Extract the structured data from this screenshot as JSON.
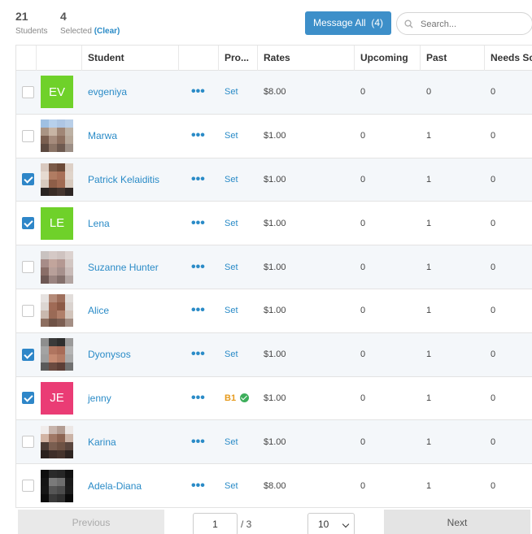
{
  "summary": {
    "students_count": "21",
    "students_label": "Students",
    "selected_count": "4",
    "selected_label": "Selected",
    "clear_label": "(Clear)"
  },
  "toolbar": {
    "message_all_label": "Message All",
    "message_all_count": "(4)",
    "search_placeholder": "Search..."
  },
  "table": {
    "headers": [
      "",
      "",
      "Student",
      "",
      "Pro...",
      "Rates",
      "Upcoming",
      "Past",
      "Needs Sc..."
    ],
    "rows": [
      {
        "checked": false,
        "avatar": {
          "type": "initials",
          "text": "EV",
          "color": "#6fd12a"
        },
        "name": "evgeniya",
        "menu": "•••",
        "program": "Set",
        "rate": "$8.00",
        "upcoming": "0",
        "past": "0",
        "needs": "0"
      },
      {
        "checked": false,
        "avatar": {
          "type": "photo",
          "palette": [
            "#9fc0e2",
            "#b7d0ec",
            "#aec6e4",
            "#b9cfe8",
            "#a99484",
            "#c7b4a4",
            "#a08676",
            "#bdb1a4",
            "#7a5f50",
            "#a58b7c",
            "#8d7060",
            "#b7a89a",
            "#5d4a40",
            "#8b7466",
            "#6e5a50",
            "#9d8f86"
          ]
        },
        "name": "Marwa",
        "menu": "•••",
        "program": "Set",
        "rate": "$1.00",
        "upcoming": "0",
        "past": "1",
        "needs": "0"
      },
      {
        "checked": true,
        "avatar": {
          "type": "photo",
          "palette": [
            "#d9c9bf",
            "#7a5a48",
            "#6b4a38",
            "#ddd0c6",
            "#e6dad0",
            "#b07c62",
            "#a87058",
            "#e0d4ca",
            "#d8cabe",
            "#8e5e48",
            "#a06a52",
            "#d6c8bc",
            "#2a2422",
            "#3a2c26",
            "#463630",
            "#2e2624"
          ]
        },
        "name": "Patrick Kelaiditis",
        "menu": "•••",
        "program": "Set",
        "rate": "$1.00",
        "upcoming": "0",
        "past": "1",
        "needs": "0"
      },
      {
        "checked": true,
        "avatar": {
          "type": "initials",
          "text": "LE",
          "color": "#6fd12a"
        },
        "name": "Lena",
        "menu": "•••",
        "program": "Set",
        "rate": "$1.00",
        "upcoming": "0",
        "past": "1",
        "needs": "0"
      },
      {
        "checked": false,
        "avatar": {
          "type": "photo",
          "palette": [
            "#c9c2c0",
            "#d5c9c6",
            "#cfc3c0",
            "#dcd2cf",
            "#a78c88",
            "#c2a59c",
            "#b49892",
            "#d2c6c2",
            "#8a6e68",
            "#b8a09a",
            "#a6908c",
            "#c9bbb8",
            "#6e5854",
            "#9a8480",
            "#84706c",
            "#b3a5a2"
          ]
        },
        "name": "Suzanne Hunter",
        "menu": "•••",
        "program": "Set",
        "rate": "$1.00",
        "upcoming": "0",
        "past": "1",
        "needs": "0"
      },
      {
        "checked": false,
        "avatar": {
          "type": "photo",
          "palette": [
            "#e6e2e0",
            "#b48a78",
            "#9e6f5c",
            "#e2ddda",
            "#dcd6d2",
            "#a06b56",
            "#8c5a46",
            "#dad3cf",
            "#c9b8ae",
            "#9a6a56",
            "#b07f6a",
            "#d2c4bb",
            "#8d6e60",
            "#6f5246",
            "#7c5e52",
            "#a48e84"
          ]
        },
        "name": "Alice",
        "menu": "•••",
        "program": "Set",
        "rate": "$1.00",
        "upcoming": "0",
        "past": "1",
        "needs": "0"
      },
      {
        "checked": true,
        "avatar": {
          "type": "photo",
          "palette": [
            "#8e8e8e",
            "#3a3a3a",
            "#2e2e2e",
            "#9a9a9a",
            "#a3a3a3",
            "#b07560",
            "#a86c58",
            "#b4b4b4",
            "#9d9d9d",
            "#c58a72",
            "#b47c66",
            "#a9a9a9",
            "#5a5a5a",
            "#6a4a40",
            "#5c3e36",
            "#707070"
          ]
        },
        "name": "Dyonysos",
        "menu": "•••",
        "program": "Set",
        "rate": "$1.00",
        "upcoming": "0",
        "past": "1",
        "needs": "0"
      },
      {
        "checked": true,
        "avatar": {
          "type": "initials",
          "text": "JE",
          "color": "#ea3c75"
        },
        "name": "jenny",
        "menu": "•••",
        "program": "B1",
        "program_ok": true,
        "rate": "$1.00",
        "upcoming": "0",
        "past": "1",
        "needs": "0"
      },
      {
        "checked": false,
        "avatar": {
          "type": "photo",
          "palette": [
            "#f0eceb",
            "#c7b4ac",
            "#b29c92",
            "#ece7e5",
            "#d2b4a4",
            "#a07866",
            "#8c6452",
            "#cbb3a6",
            "#4a3a34",
            "#7a5e50",
            "#6e5244",
            "#5a463e",
            "#2a201c",
            "#3e2e28",
            "#46342c",
            "#2e2420"
          ]
        },
        "name": "Karina",
        "menu": "•••",
        "program": "Set",
        "rate": "$1.00",
        "upcoming": "0",
        "past": "1",
        "needs": "0"
      },
      {
        "checked": false,
        "avatar": {
          "type": "photo",
          "palette": [
            "#0e0e0e",
            "#2a2a2a",
            "#262626",
            "#111111",
            "#141414",
            "#7a7a7a",
            "#6e6e6e",
            "#1a1a1a",
            "#161616",
            "#565656",
            "#4c4c4c",
            "#1c1c1c",
            "#0c0c0c",
            "#3a3a3a",
            "#303030",
            "#0a0a0a"
          ]
        },
        "name": "Adela-Diana",
        "menu": "•••",
        "program": "Set",
        "rate": "$8.00",
        "upcoming": "0",
        "past": "1",
        "needs": "0"
      }
    ]
  },
  "pager": {
    "previous_label": "Previous",
    "page_value": "1",
    "total_label": "/ 3",
    "page_size": "10",
    "next_label": "Next"
  }
}
